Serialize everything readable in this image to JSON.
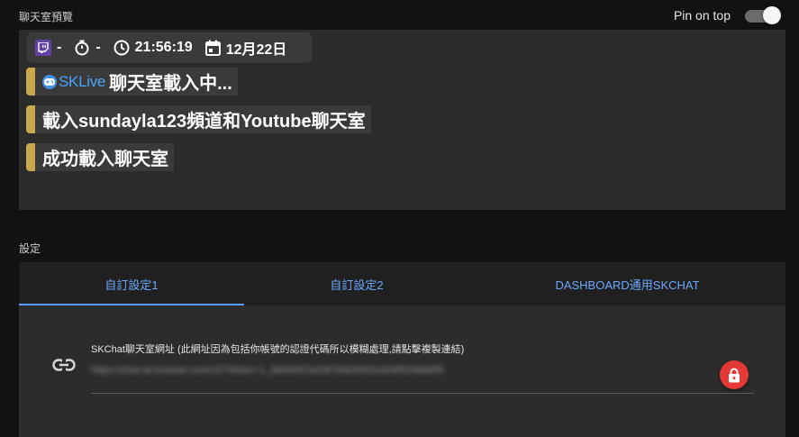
{
  "preview": {
    "section_label": "聊天室預覽",
    "status_bar": {
      "platform_icon": "twitch-icon",
      "viewers": "-",
      "uptime": "-",
      "time": "21:56:19",
      "date": "12月22日"
    },
    "messages": [
      {
        "badge": "SKLive",
        "text": "聊天室載入中..."
      },
      {
        "text": "載入sundayla123頻道和Youtube聊天室"
      },
      {
        "text": "成功載入聊天室"
      }
    ],
    "accent_color": "#c9a94b"
  },
  "pin": {
    "label": "Pin on top",
    "enabled": true
  },
  "settings": {
    "section_label": "設定",
    "tabs": [
      {
        "label": "自訂設定1",
        "active": true
      },
      {
        "label": "自訂設定2",
        "active": false
      },
      {
        "label": "DASHBOARD通用SKCHAT",
        "active": false
      }
    ],
    "url_field": {
      "label": "SKChat聊天室網址 (此網址因為包括你帳號的認證代碼所以模糊處理,請點擊複製連結)",
      "value": "https://chat.sk-knower.com/v2/?token=1_8b0d557a2387bde3091e3cbf524bb895"
    }
  }
}
